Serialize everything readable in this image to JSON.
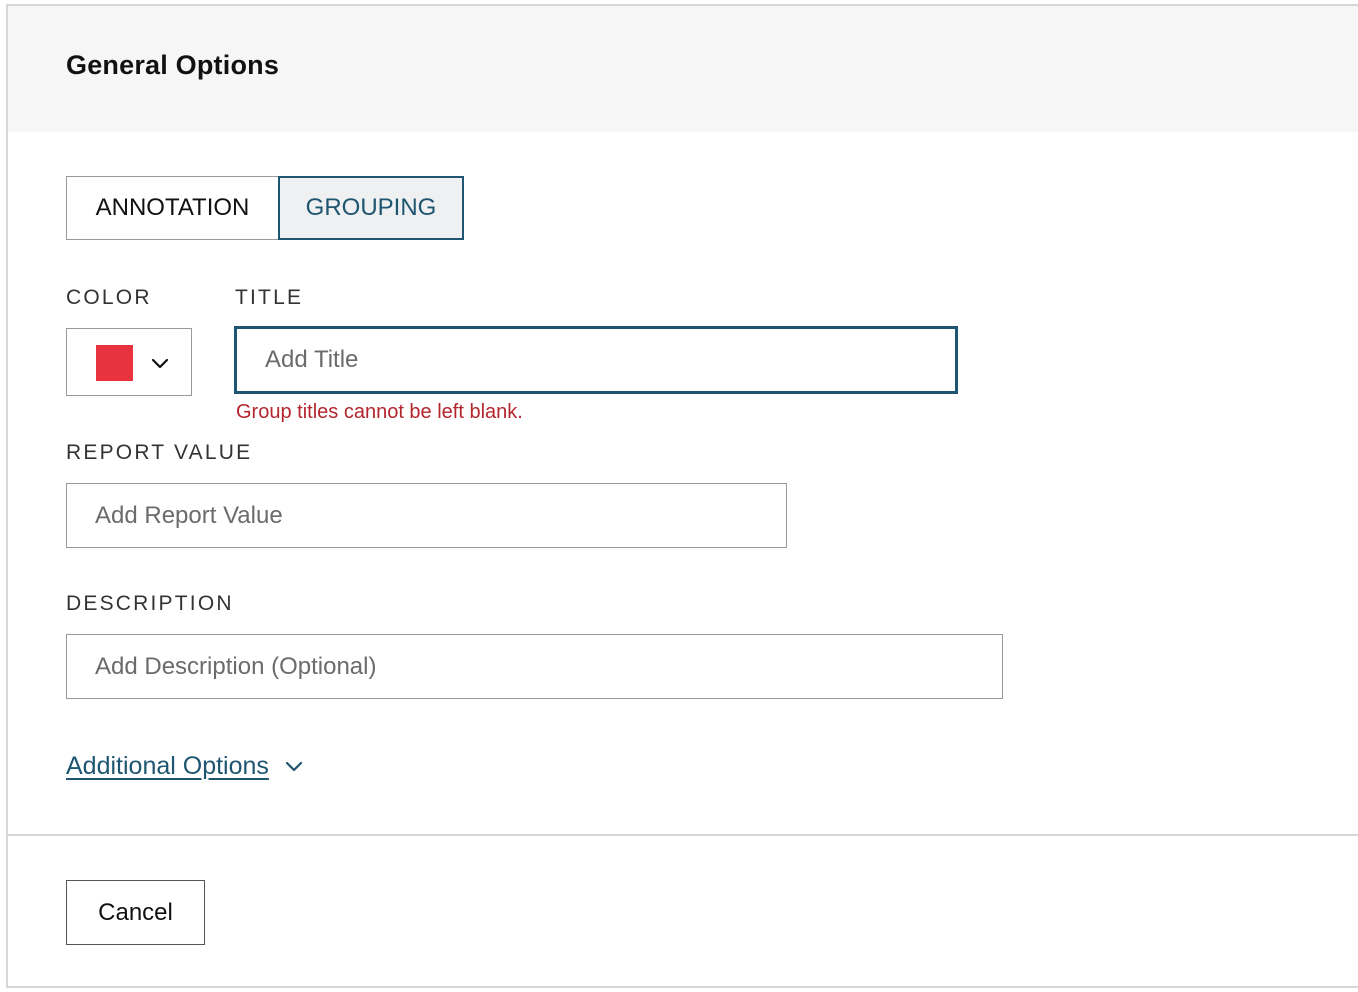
{
  "header": {
    "title": "General Options"
  },
  "tabs": [
    {
      "label": "ANNOTATION",
      "selected": false
    },
    {
      "label": "GROUPING",
      "selected": true
    }
  ],
  "form": {
    "color": {
      "label": "COLOR",
      "selected_color": "#e8333f",
      "dropdown_icon": "chevron-down-icon"
    },
    "title": {
      "label": "TITLE",
      "value": "",
      "placeholder": "Add Title",
      "error": "Group titles cannot be left blank."
    },
    "report_value": {
      "label": "REPORT VALUE",
      "value": "",
      "placeholder": "Add Report Value"
    },
    "description": {
      "label": "DESCRIPTION",
      "value": "",
      "placeholder": "Add Description (Optional)"
    },
    "additional_options": {
      "label": "Additional Options",
      "icon": "chevron-down-icon"
    }
  },
  "footer": {
    "cancel_label": "Cancel"
  },
  "colors": {
    "accent": "#1e5570",
    "error": "#b3262d",
    "border": "#9a9a9a",
    "header_bg": "#f6f6f7"
  }
}
